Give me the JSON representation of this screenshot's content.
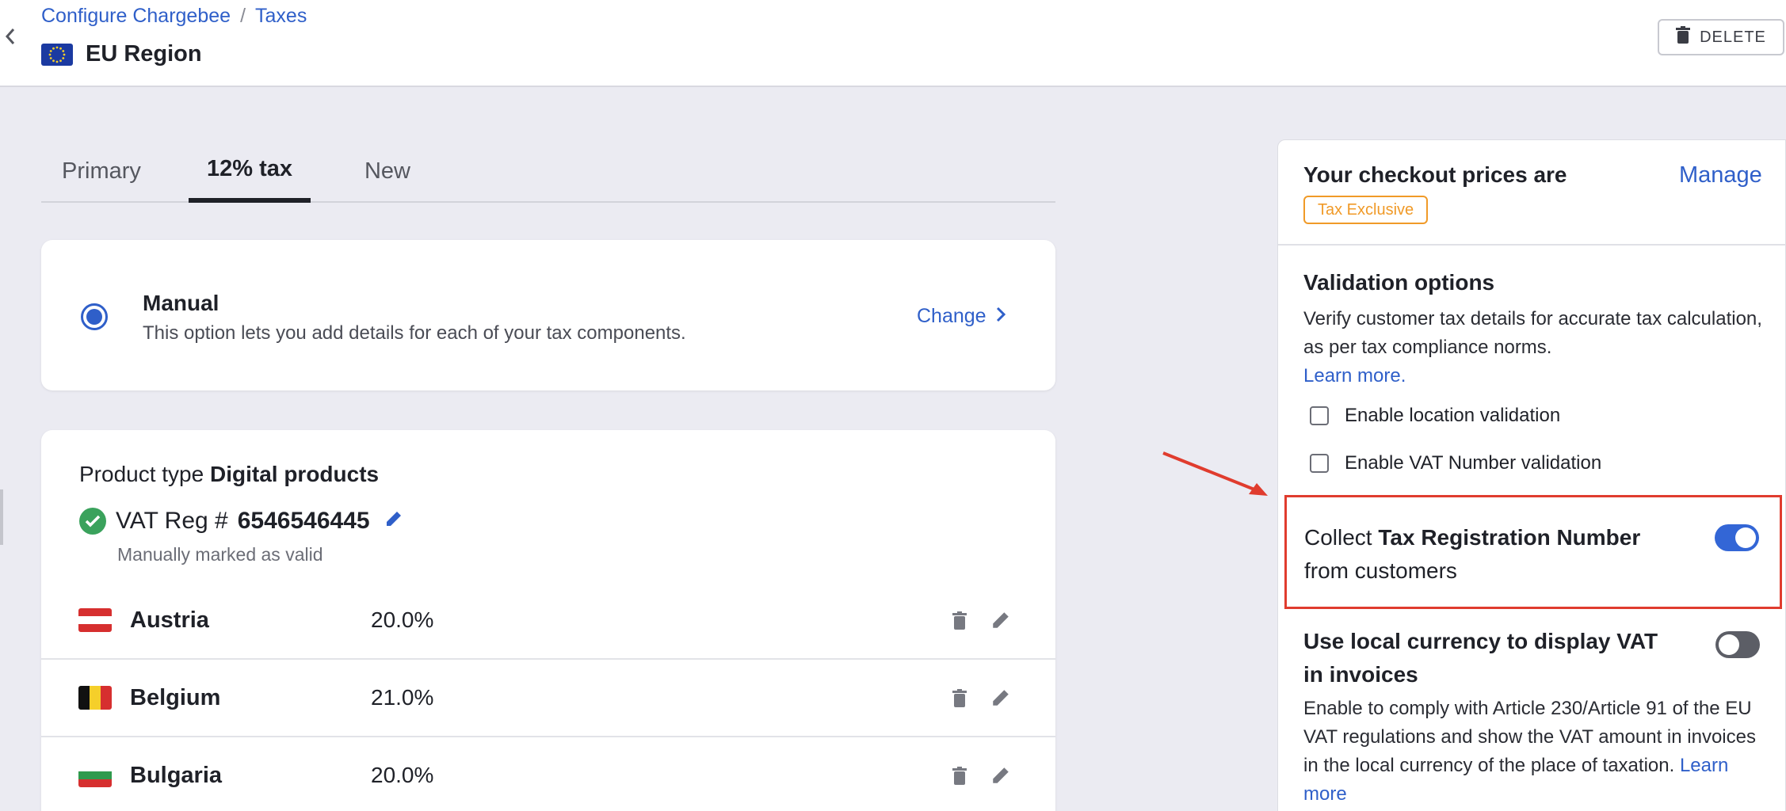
{
  "header": {
    "breadcrumbs": [
      "Configure Chargebee",
      "Taxes"
    ],
    "title": "EU Region",
    "delete_label": "DELETE"
  },
  "tabs": [
    {
      "label": "Primary",
      "active": false
    },
    {
      "label": "12% tax",
      "active": true
    },
    {
      "label": "New",
      "active": false
    }
  ],
  "manual": {
    "title": "Manual",
    "description": "This option lets you add details for each of your tax components.",
    "change_label": "Change"
  },
  "product": {
    "prefix": "Product type",
    "type": "Digital products",
    "vat_prefix": "VAT Reg #",
    "vat_number": "6546546445",
    "vat_note": "Manually marked as valid",
    "countries": [
      {
        "name": "Austria",
        "rate": "20.0%"
      },
      {
        "name": "Belgium",
        "rate": "21.0%"
      },
      {
        "name": "Bulgaria",
        "rate": "20.0%"
      }
    ]
  },
  "right_panel": {
    "checkout_title": "Your checkout prices are",
    "manage_label": "Manage",
    "tax_badge": "Tax Exclusive",
    "validation_title": "Validation options",
    "validation_desc": "Verify customer tax details for accurate tax calculation, as per tax compliance norms.",
    "learn_more": "Learn more.",
    "options": [
      {
        "label": "Enable location validation",
        "checked": false
      },
      {
        "label": "Enable VAT Number validation",
        "checked": false
      }
    ],
    "collect_prefix": "Collect",
    "collect_bold": "Tax Registration Number",
    "collect_suffix": "from customers",
    "collect_enabled": true,
    "local_title": "Use local currency to display VAT in invoices",
    "local_enabled": false,
    "local_desc": "Enable to comply with Article 230/Article 91 of the EU VAT regulations and show the VAT amount in invoices in the local currency of the place of taxation.",
    "local_learn_more": "Learn more"
  },
  "colors": {
    "accent": "#2f5fc9",
    "badge": "#f09a28",
    "highlight": "#e03c2e",
    "success": "#3aa25c"
  }
}
